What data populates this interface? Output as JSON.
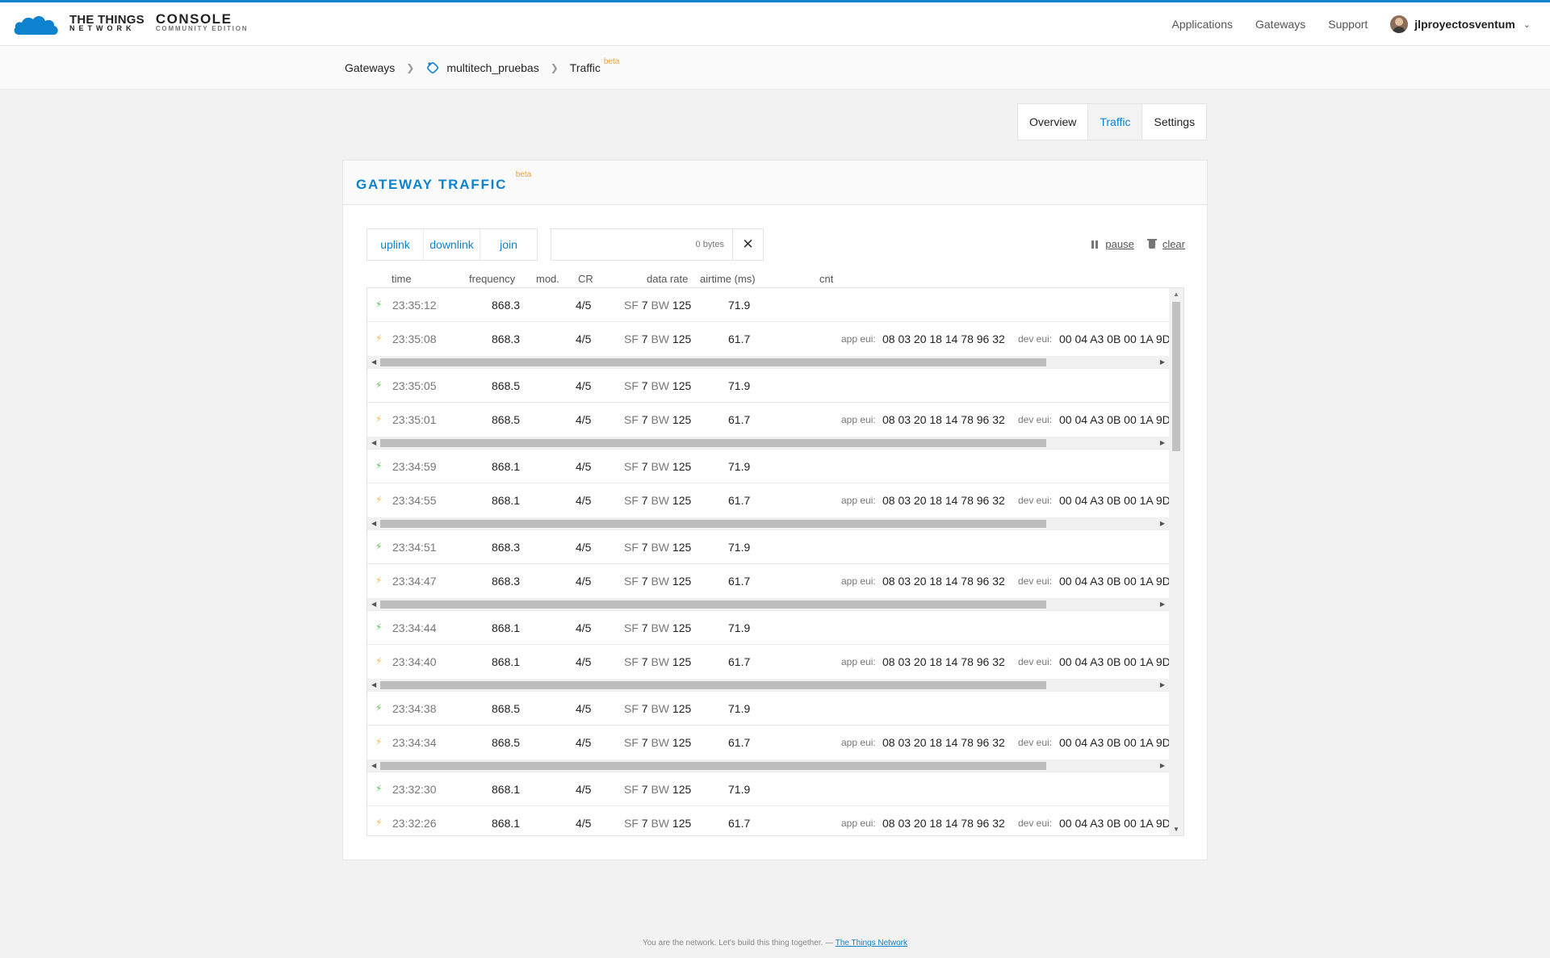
{
  "header": {
    "logo_line1": "THE THINGS",
    "logo_line2": "NETWORK",
    "console_line1": "CONSOLE",
    "console_line2": "COMMUNITY EDITION",
    "nav": [
      "Applications",
      "Gateways",
      "Support"
    ],
    "username": "jlproyectosventum"
  },
  "breadcrumb": {
    "gateways": "Gateways",
    "gateway_id": "multitech_pruebas",
    "current": "Traffic",
    "beta": "beta"
  },
  "tabs": [
    "Overview",
    "Traffic",
    "Settings"
  ],
  "active_tab": "Traffic",
  "card": {
    "title": "GATEWAY TRAFFIC",
    "beta": "beta",
    "filters": [
      "uplink",
      "downlink",
      "join"
    ],
    "search_placeholder": "0 bytes",
    "pause_label": "pause",
    "clear_label": "clear"
  },
  "columns": [
    "time",
    "frequency",
    "mod.",
    "CR",
    "data rate",
    "airtime (ms)",
    "cnt"
  ],
  "labels": {
    "sf": "SF",
    "bw": "BW",
    "app_eui": "app eui:",
    "dev_eui": "dev eui:"
  },
  "rows": [
    {
      "type": "uplink",
      "time": "23:35:12",
      "freq": "868.3",
      "cr": "4/5",
      "sf": "7",
      "bw": "125",
      "airtime": "71.9"
    },
    {
      "type": "downlink",
      "time": "23:35:08",
      "freq": "868.3",
      "cr": "4/5",
      "sf": "7",
      "bw": "125",
      "airtime": "61.7",
      "app_eui": "08 03 20 18 14 78 96 32",
      "dev_eui": "00 04 A3 0B 00 1A 9D"
    },
    {
      "type": "uplink",
      "time": "23:35:05",
      "freq": "868.5",
      "cr": "4/5",
      "sf": "7",
      "bw": "125",
      "airtime": "71.9"
    },
    {
      "type": "downlink",
      "time": "23:35:01",
      "freq": "868.5",
      "cr": "4/5",
      "sf": "7",
      "bw": "125",
      "airtime": "61.7",
      "app_eui": "08 03 20 18 14 78 96 32",
      "dev_eui": "00 04 A3 0B 00 1A 9D"
    },
    {
      "type": "uplink",
      "time": "23:34:59",
      "freq": "868.1",
      "cr": "4/5",
      "sf": "7",
      "bw": "125",
      "airtime": "71.9"
    },
    {
      "type": "downlink",
      "time": "23:34:55",
      "freq": "868.1",
      "cr": "4/5",
      "sf": "7",
      "bw": "125",
      "airtime": "61.7",
      "app_eui": "08 03 20 18 14 78 96 32",
      "dev_eui": "00 04 A3 0B 00 1A 9D"
    },
    {
      "type": "uplink",
      "time": "23:34:51",
      "freq": "868.3",
      "cr": "4/5",
      "sf": "7",
      "bw": "125",
      "airtime": "71.9"
    },
    {
      "type": "downlink",
      "time": "23:34:47",
      "freq": "868.3",
      "cr": "4/5",
      "sf": "7",
      "bw": "125",
      "airtime": "61.7",
      "app_eui": "08 03 20 18 14 78 96 32",
      "dev_eui": "00 04 A3 0B 00 1A 9D"
    },
    {
      "type": "uplink",
      "time": "23:34:44",
      "freq": "868.1",
      "cr": "4/5",
      "sf": "7",
      "bw": "125",
      "airtime": "71.9"
    },
    {
      "type": "downlink",
      "time": "23:34:40",
      "freq": "868.1",
      "cr": "4/5",
      "sf": "7",
      "bw": "125",
      "airtime": "61.7",
      "app_eui": "08 03 20 18 14 78 96 32",
      "dev_eui": "00 04 A3 0B 00 1A 9D"
    },
    {
      "type": "uplink",
      "time": "23:34:38",
      "freq": "868.5",
      "cr": "4/5",
      "sf": "7",
      "bw": "125",
      "airtime": "71.9"
    },
    {
      "type": "downlink",
      "time": "23:34:34",
      "freq": "868.5",
      "cr": "4/5",
      "sf": "7",
      "bw": "125",
      "airtime": "61.7",
      "app_eui": "08 03 20 18 14 78 96 32",
      "dev_eui": "00 04 A3 0B 00 1A 9D"
    },
    {
      "type": "uplink",
      "time": "23:32:30",
      "freq": "868.1",
      "cr": "4/5",
      "sf": "7",
      "bw": "125",
      "airtime": "71.9"
    },
    {
      "type": "downlink",
      "time": "23:32:26",
      "freq": "868.1",
      "cr": "4/5",
      "sf": "7",
      "bw": "125",
      "airtime": "61.7",
      "app_eui": "08 03 20 18 14 78 96 32",
      "dev_eui": "00 04 A3 0B 00 1A 9D"
    }
  ],
  "footer": {
    "text": "You are the network. Let's build this thing together. — ",
    "link": "The Things Network"
  },
  "colors": {
    "accent": "#0d83d0",
    "uplink_icon": "#5ac85a",
    "downlink_icon": "#f2b84c",
    "beta": "#e8a23a"
  }
}
